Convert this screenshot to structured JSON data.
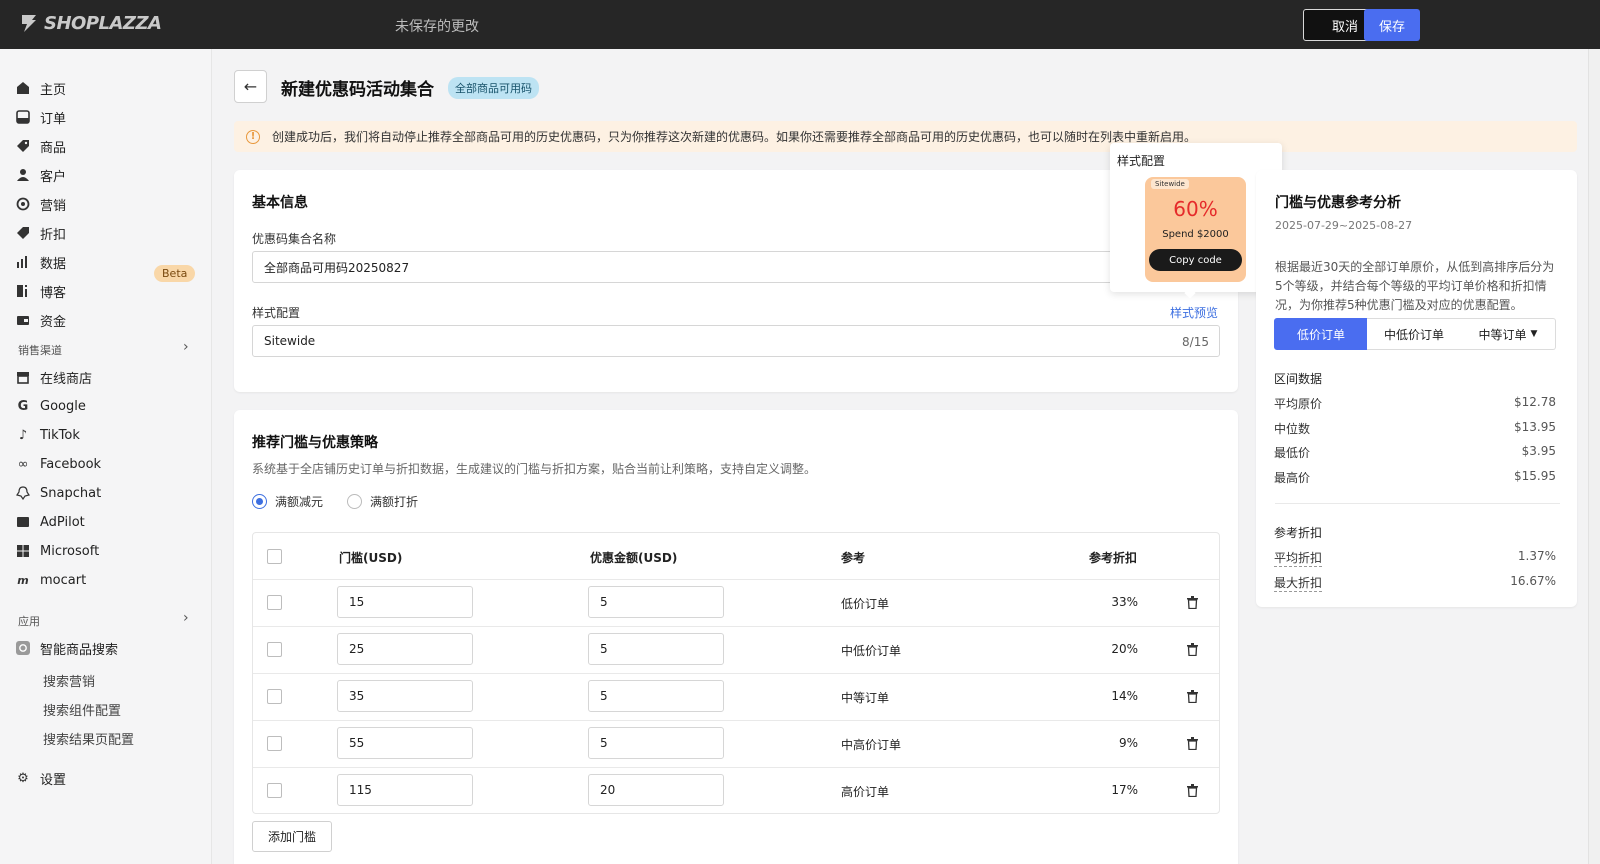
{
  "app": {
    "logo": "SHOPLAZZA",
    "status": "未保存的更改",
    "cancel_label": "取消",
    "save_label": "保存"
  },
  "sidebar": {
    "items": [
      {
        "label": "主页",
        "icon": "home-icon"
      },
      {
        "label": "订单",
        "icon": "orders-icon"
      },
      {
        "label": "商品",
        "icon": "tag-icon"
      },
      {
        "label": "客户",
        "icon": "person-icon"
      },
      {
        "label": "营销",
        "icon": "marketing-icon"
      },
      {
        "label": "折扣",
        "icon": "discount-icon",
        "badge": "Beta"
      },
      {
        "label": "数据",
        "icon": "chart-icon"
      },
      {
        "label": "博客",
        "icon": "blog-icon"
      },
      {
        "label": "资金",
        "icon": "wallet-icon"
      }
    ],
    "channels_label": "销售渠道",
    "channels": [
      {
        "label": "在线商店",
        "icon": "store-icon"
      },
      {
        "label": "Google",
        "icon": "google-icon"
      },
      {
        "label": "TikTok",
        "icon": "tiktok-icon"
      },
      {
        "label": "Facebook",
        "icon": "meta-icon"
      },
      {
        "label": "Snapchat",
        "icon": "snapchat-icon"
      },
      {
        "label": "AdPilot",
        "icon": "adpilot-icon"
      },
      {
        "label": "Microsoft",
        "icon": "microsoft-icon"
      },
      {
        "label": "mocart",
        "icon": "mocart-icon"
      }
    ],
    "apps_label": "应用",
    "app_name": "智能商品搜索",
    "app_subitems": [
      "搜索营销",
      "搜索组件配置",
      "搜索结果页配置"
    ],
    "settings_label": "设置"
  },
  "page": {
    "title": "新建优惠码活动集合",
    "badge": "全部商品可用码",
    "banner": "创建成功后，我们将自动停止推荐全部商品可用的历史优惠码，只为你推荐这次新建的优惠码。如果你还需要推荐全部商品可用的历史优惠码，也可以随时在列表中重新启用。"
  },
  "basic": {
    "title": "基本信息",
    "name_label": "优惠码集合名称",
    "name_value": "全部商品可用码20250827",
    "style_label": "样式配置",
    "style_value": "Sitewide",
    "style_counter": "8/15",
    "preview_link": "样式预览"
  },
  "popover": {
    "title": "样式配置",
    "tag": "Sitewide",
    "percent": "60%",
    "spend": "Spend $2000",
    "button": "Copy code"
  },
  "strategy": {
    "title": "推荐门槛与优惠策略",
    "desc": "系统基于全店铺历史订单与折扣数据，生成建议的门槛与折扣方案，贴合当前让利策略，支持自定义调整。",
    "radio_1": "满额减元",
    "radio_2": "满额打折",
    "selected": "满额减元",
    "columns": [
      "门槛(USD)",
      "优惠金额(USD)",
      "参考",
      "参考折扣"
    ],
    "rows": [
      {
        "threshold": "15",
        "amount": "5",
        "ref": "低价订单",
        "pct": "33%"
      },
      {
        "threshold": "25",
        "amount": "5",
        "ref": "中低价订单",
        "pct": "20%"
      },
      {
        "threshold": "35",
        "amount": "5",
        "ref": "中等订单",
        "pct": "14%"
      },
      {
        "threshold": "55",
        "amount": "5",
        "ref": "中高价订单",
        "pct": "9%"
      },
      {
        "threshold": "115",
        "amount": "20",
        "ref": "高价订单",
        "pct": "17%"
      }
    ],
    "add_label": "添加门槛"
  },
  "analysis": {
    "title": "门槛与优惠参考分析",
    "date_range": "2025-07-29~2025-08-27",
    "desc": "根据最近30天的全部订单原价，从低到高排序后分为5个等级，并结合每个等级的平均订单价格和折扣情况，为你推荐5种优惠门槛及对应的优惠配置。",
    "tabs": [
      "低价订单",
      "中低价订单",
      "中等订单"
    ],
    "active_tab": "低价订单",
    "range_title": "区间数据",
    "range": [
      {
        "label": "平均原价",
        "value": "$12.78"
      },
      {
        "label": "中位数",
        "value": "$13.95"
      },
      {
        "label": "最低价",
        "value": "$3.95"
      },
      {
        "label": "最高价",
        "value": "$15.95"
      }
    ],
    "discount_title": "参考折扣",
    "discount": [
      {
        "label": "平均折扣",
        "value": "1.37%"
      },
      {
        "label": "最大折扣",
        "value": "16.67%"
      }
    ]
  },
  "colors": {
    "primary": "#4a6df0",
    "topbar": "#262626",
    "badge_bg": "#bde3f3",
    "banner_bg": "#fdf1e3",
    "coupon_bg": "#fbc89b"
  }
}
